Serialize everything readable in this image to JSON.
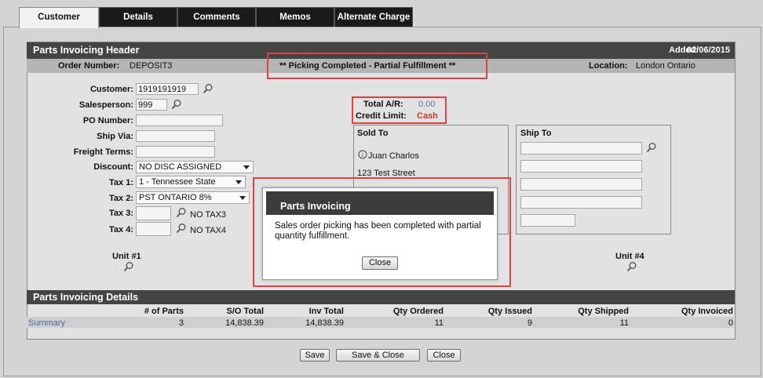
{
  "tabs": [
    {
      "label": "Customer"
    },
    {
      "label": "Details"
    },
    {
      "label": "Comments"
    },
    {
      "label": "Memos"
    },
    {
      "label": "Alternate Charge"
    }
  ],
  "header": {
    "title": "Parts Invoicing Header",
    "added_label": "Added:",
    "added_value": "02/06/2015",
    "order_label": "Order Number:",
    "order_value": "DEPOSIT3",
    "status": "** Picking Completed - Partial Fulfillment **",
    "location_label": "Location:",
    "location_value": "London Ontario"
  },
  "form": {
    "customer_label": "Customer:",
    "customer_value": "1919191919",
    "salesperson_label": "Salesperson:",
    "salesperson_value": "999",
    "po_label": "PO Number:",
    "shipvia_label": "Ship Via:",
    "freight_label": "Freight Terms:",
    "discount_label": "Discount:",
    "discount_value": "NO DISC ASSIGNED",
    "tax1_label": "Tax 1:",
    "tax1_value": "1 - Tennessee State",
    "tax2_label": "Tax 2:",
    "tax2_value": "PST ONTARIO 8%",
    "tax3_label": "Tax 3:",
    "tax3_text": "NO TAX3",
    "tax4_label": "Tax 4:",
    "tax4_text": "NO TAX4",
    "unit1_label": "Unit #1",
    "unit4_label": "Unit #4"
  },
  "ar": {
    "total_label": "Total A/R:",
    "total_value": "0.00",
    "credit_label": "Credit Limit:",
    "credit_value": "Cash"
  },
  "soldto": {
    "title": "Sold To",
    "name": "Juan Charlos",
    "street": "123 Test Street"
  },
  "shipto": {
    "title": "Ship To"
  },
  "dialog": {
    "title": "Parts Invoicing",
    "message": "Sales order picking has been completed with partial quantity fulfillment.",
    "close_label": "Close"
  },
  "details": {
    "title": "Parts Invoicing Details",
    "columns": [
      "# of Parts",
      "S/O Total",
      "Inv Total",
      "Qty Ordered",
      "Qty Issued",
      "Qty Shipped",
      "Qty Invoiced"
    ],
    "row_label": "Summary",
    "row": [
      "3",
      "14,838.39",
      "14,838.39",
      "11",
      "9",
      "11",
      "0"
    ]
  },
  "buttons": {
    "save": "Save",
    "save_close": "Save & Close",
    "close": "Close"
  },
  "colors": {
    "highlight_red": "#e04040",
    "credit_red": "#c0392b",
    "ar_value": "#5a7a9a",
    "header_bar": "#444444"
  }
}
